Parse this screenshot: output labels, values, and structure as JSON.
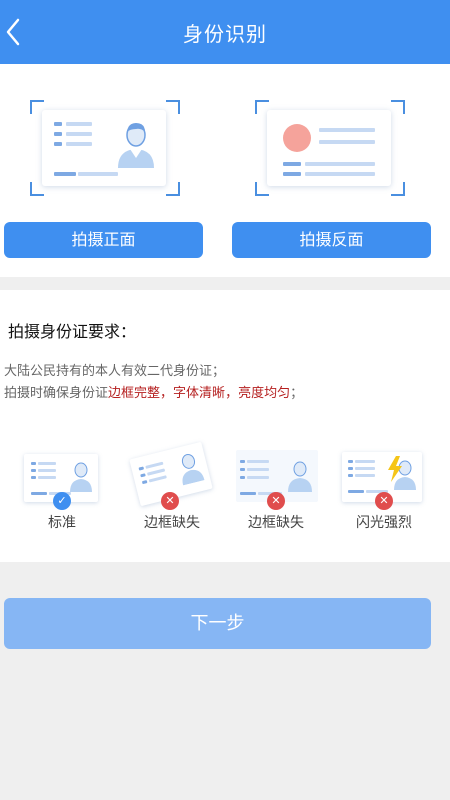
{
  "header": {
    "title": "身份识别",
    "back_icon": "chevron-left-icon"
  },
  "capture": {
    "front_button": "拍摄正面",
    "back_button": "拍摄反面"
  },
  "requirements": {
    "title": "拍摄身份证要求：",
    "line1": "大陆公民持有的本人有效二代身份证；",
    "line2_prefix": "拍摄时确保身份证",
    "highlight1": "边框完整",
    "sep1": "，",
    "highlight2": "字体清晰",
    "sep2": "，",
    "highlight3": "亮度均匀",
    "line2_suffix": "；"
  },
  "examples": [
    {
      "label": "标准",
      "status": "ok"
    },
    {
      "label": "边框缺失",
      "status": "bad"
    },
    {
      "label": "边框缺失",
      "status": "bad"
    },
    {
      "label": "闪光强烈",
      "status": "bad"
    }
  ],
  "next_button": "下一步",
  "colors": {
    "primary": "#3f8ff0",
    "disabled": "#86b6f4",
    "highlight": "#b51f1f",
    "error": "#e04d4d"
  }
}
